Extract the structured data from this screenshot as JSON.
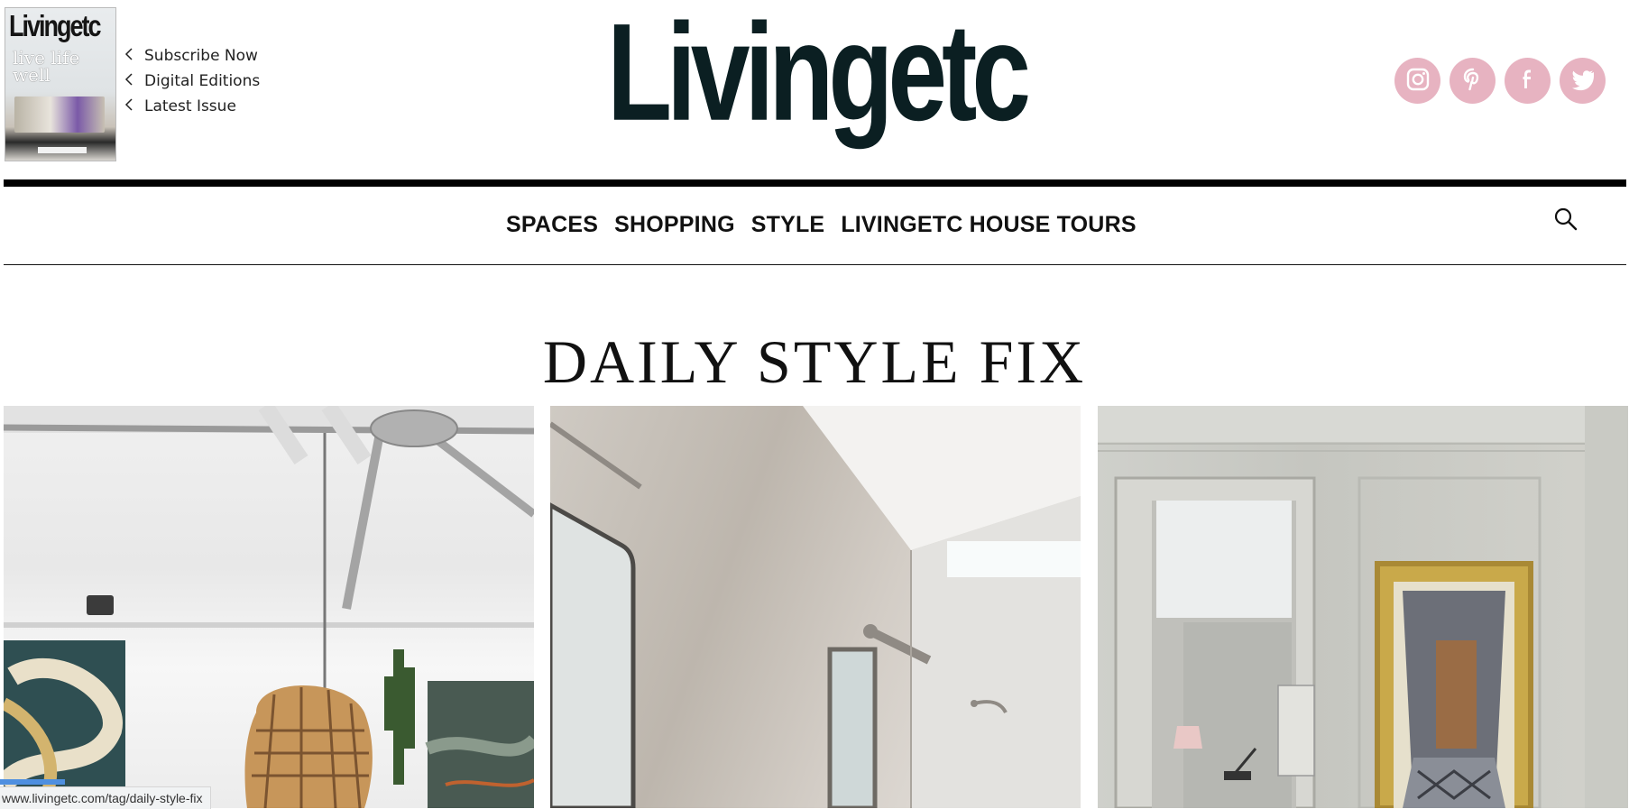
{
  "header": {
    "magazine_cover": {
      "title": "Livingetc",
      "tagline": "live life well"
    },
    "quick_links": [
      {
        "label": "Subscribe Now",
        "icon": "chevron-left-icon"
      },
      {
        "label": "Digital Editions",
        "icon": "chevron-left-icon"
      },
      {
        "label": "Latest Issue",
        "icon": "chevron-left-icon"
      }
    ],
    "brand": "Livingetc",
    "social": [
      {
        "name": "instagram-icon"
      },
      {
        "name": "pinterest-icon"
      },
      {
        "name": "facebook-icon"
      },
      {
        "name": "twitter-icon"
      }
    ]
  },
  "nav": {
    "items": [
      "SPACES",
      "SHOPPING",
      "STYLE",
      "LIVINGETC HOUSE TOURS"
    ],
    "search_icon": "search-icon"
  },
  "page": {
    "title": "DAILY STYLE FIX"
  },
  "cards": [
    {
      "image": "loft-hanging-chair-photo"
    },
    {
      "image": "bathroom-mirror-photo"
    },
    {
      "image": "hallway-artwork-photo"
    }
  ],
  "status_bar": {
    "url": "www.livingetc.com/tag/daily-style-fix"
  },
  "colors": {
    "brand_text": "#0b1f22",
    "social_circle": "#e7b3c1",
    "rule": "#000000",
    "background": "#ffffff"
  }
}
